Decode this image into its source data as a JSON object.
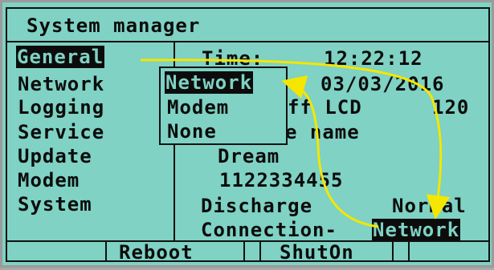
{
  "header": {
    "title": "System manager"
  },
  "menu": {
    "items": [
      {
        "label": "General",
        "selected": true
      },
      {
        "label": "Network"
      },
      {
        "label": "Logging"
      },
      {
        "label": "Service"
      },
      {
        "label": "Update"
      },
      {
        "label": "Modem"
      },
      {
        "label": "System"
      }
    ]
  },
  "details": {
    "time_label": "Time:",
    "time_value": "12:22:12",
    "date_value": "03/03/2016",
    "lcd_off_partial": "ff LCD",
    "lcd_off_value": "120",
    "name_partial": "e name",
    "name_value": "Dream",
    "phone_value": "1122334455",
    "discharge_label": "Discharge",
    "discharge_value": "Normal",
    "connection_label": "Connection-",
    "connection_value": "Network"
  },
  "popup": {
    "options": [
      {
        "label": "Network",
        "selected": true
      },
      {
        "label": "Modem"
      },
      {
        "label": "None"
      }
    ]
  },
  "footer": {
    "buttons": [
      {
        "label": "Reboot"
      },
      {
        "label": "ShutOn"
      }
    ]
  },
  "colors": {
    "lcd_background": "#7fd2c4",
    "lcd_text": "#0c0c0c",
    "annotation_arrow": "#f5e600"
  }
}
